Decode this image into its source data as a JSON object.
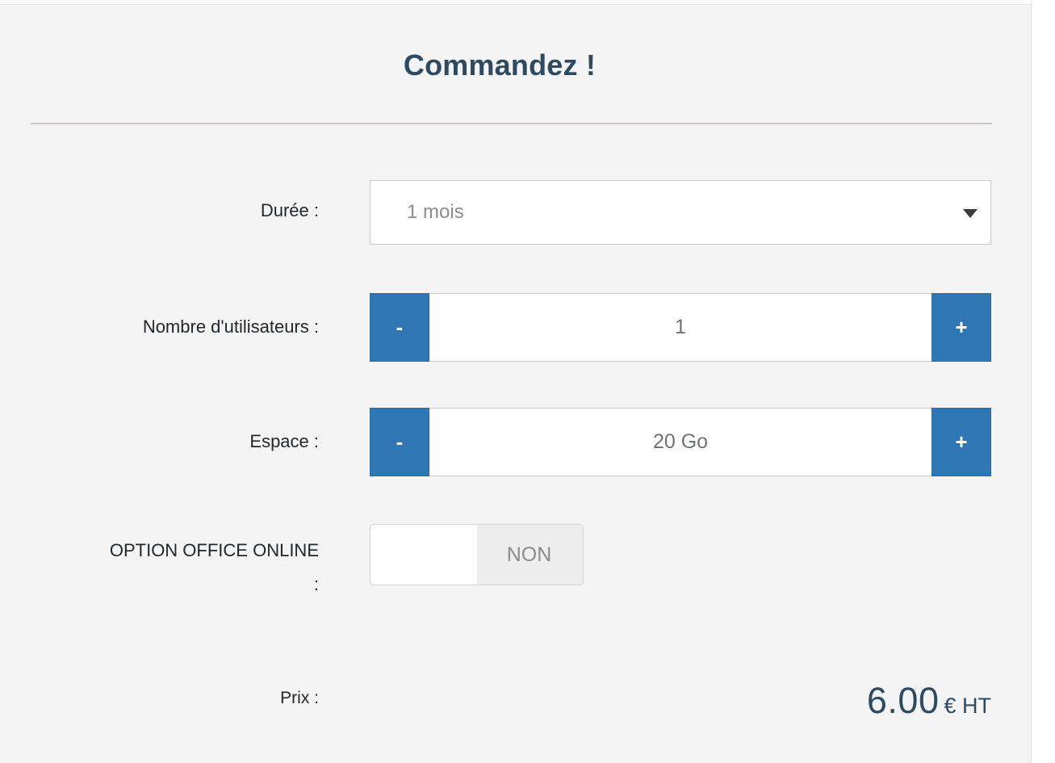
{
  "panel": {
    "title": "Commandez !",
    "accent_blue": "#2e76b4",
    "title_color": "#2d4a63",
    "background": "#f4f4f4"
  },
  "form": {
    "duration": {
      "label": "Durée :",
      "selected_option": "1 mois",
      "caret_icon": "chevron-down-icon"
    },
    "users": {
      "label": "Nombre d'utilisateurs :",
      "value": "1",
      "decrement_label": "-",
      "increment_label": "+"
    },
    "space": {
      "label": "Espace :",
      "value": "20 Go",
      "decrement_label": "-",
      "increment_label": "+"
    },
    "office_online": {
      "label_line1": "OPTION OFFICE ONLINE",
      "label_line2": ":",
      "state_label": "NON"
    },
    "price": {
      "label": "Prix :",
      "amount": "6.00",
      "unit": "€ HT"
    }
  }
}
